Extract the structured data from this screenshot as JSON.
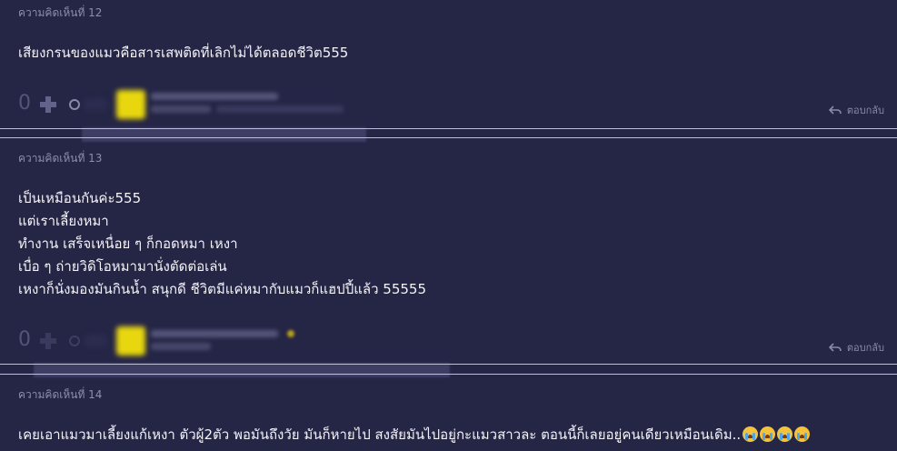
{
  "comments": [
    {
      "header": "ความคิดเห็นที่ 12",
      "body_lines": [
        "เสียงกรนของแมวคือสารเสพติดที่เลิกไม่ได้ตลอดชีวิต555"
      ],
      "score": "0",
      "reply_label": "ตอบกลับ"
    },
    {
      "header": "ความคิดเห็นที่ 13",
      "body_lines": [
        "เป็นเหมือนกันค่ะ555",
        "แต่เราเลี้ยงหมา",
        "ทำงาน เสร็จเหนื่อย ๆ ก็กอดหมา เหงา",
        "เบื่อ ๆ ถ่ายวิดิโอหมามานั่งตัดต่อเล่น",
        "เหงาก็นั่งมองมันกินน้ำ สนุกดี ชีวิตมีแค่หมากับแมวก็แฮปปี้แล้ว 55555"
      ],
      "score": "0",
      "reply_label": "ตอบกลับ"
    },
    {
      "header": "ความคิดเห็นที่ 14",
      "body_lines": [
        "เคยเอาแมวมาเลี้ยงแก้เหงา ตัวผู้2ตัว  พอมันถึงวัย  มันก็หายไป  สงสัยมันไปอยู่กะแมวสาวละ  ตอนนี้ก็เลยอยู่คนเดียวเหมือนเดิม.."
      ]
    }
  ],
  "icons": {
    "plus": "plus-icon",
    "emoji": "emoji-reaction-icon",
    "reply": "reply-arrow-icon",
    "crying": "loudly-crying-face-icon"
  },
  "colors": {
    "background": "#252546",
    "avatar": "#e8d70e",
    "muted_text": "#8d8dae"
  }
}
